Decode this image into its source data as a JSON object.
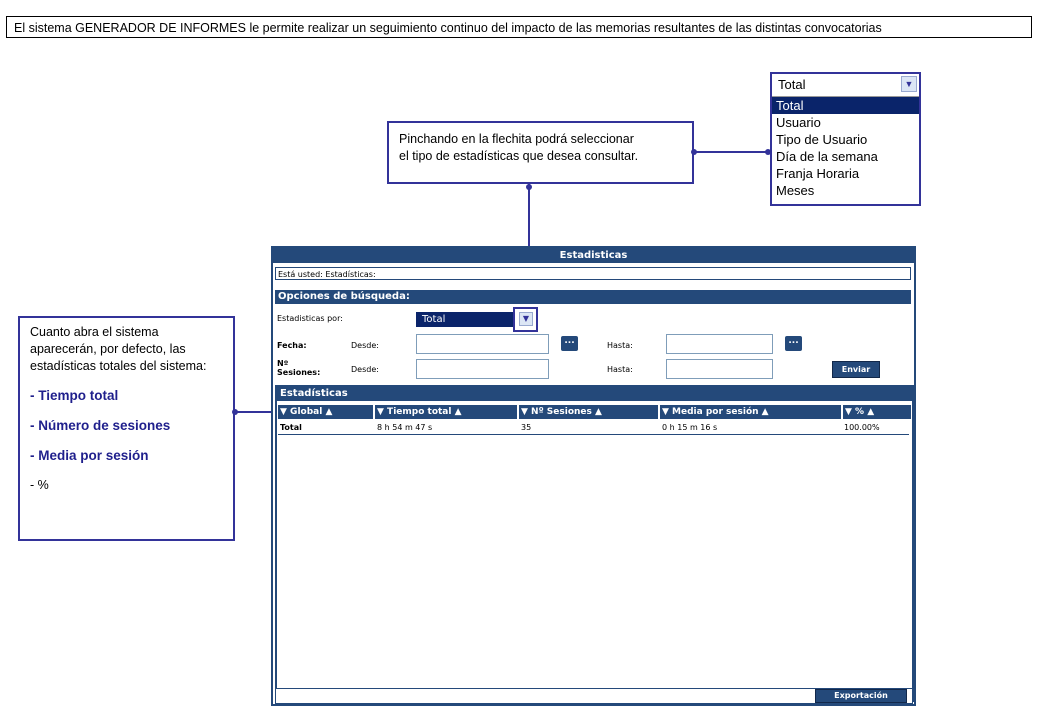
{
  "banner": "El sistema GENERADOR DE INFORMES le permite realizar un seguimiento continuo del impacto de las memorias resultantes de las distintas convocatorias",
  "callout_top": {
    "line1": "Pinchando en la flechita podrá seleccionar",
    "line2": "el tipo de estadísticas que desea consultar."
  },
  "callout_left": {
    "intro": "Cuanto abra el sistema aparecerán, por defecto, las estadísticas totales del sistema:",
    "items": [
      "- Tiempo total",
      "- Número de sesiones",
      "- Media por sesión",
      "- %"
    ]
  },
  "dropdown_demo": {
    "selected": "Total",
    "options": [
      "Total",
      "Usuario",
      "Tipo de Usuario",
      "Día de la semana",
      "Franja Horaria",
      "Meses"
    ]
  },
  "window": {
    "title": "Estadisticas",
    "breadcrumb": "Está usted: Estadísticas:",
    "search_header": "Opciones de búsqueda:",
    "stats_by_label": "Estadisticas por:",
    "stats_by_value": "Total",
    "fecha_label": "Fecha:",
    "sesiones_label_1": "Nº",
    "sesiones_label_2": "Sesiones:",
    "desde": "Desde:",
    "hasta": "Hasta:",
    "cal_btn": "...",
    "enviar": "Enviar",
    "results_header": "Estadísticas",
    "columns": [
      "▼ Global ▲",
      "▼ Tiempo total ▲",
      "▼ Nº Sesiones ▲",
      "▼ Media por sesión ▲",
      "▼ % ▲"
    ],
    "row": [
      "Total",
      "8 h 54 m 47 s",
      "35",
      "0 h 15 m 16 s",
      "100.00%"
    ],
    "export": "Exportación"
  },
  "colors": {
    "window_accent": "#24497a",
    "callout_border": "#333399",
    "selection": "#0a246a"
  }
}
